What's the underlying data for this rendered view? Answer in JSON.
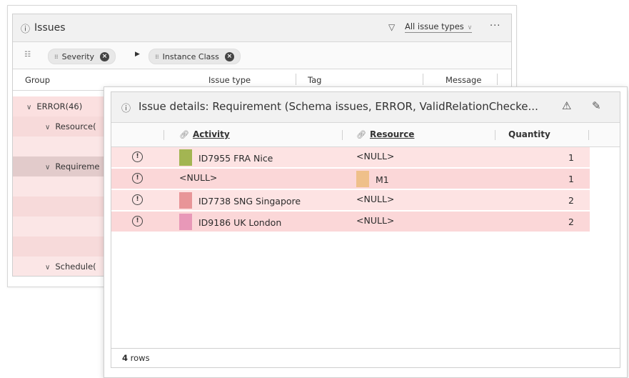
{
  "issues_panel": {
    "title": "Issues",
    "filter_label": "All issue types",
    "more_label": "···",
    "group_chips": [
      "Severity",
      "Instance Class"
    ],
    "columns": [
      "Group",
      "Issue type",
      "Tag",
      "Message"
    ],
    "groups": [
      "ERROR(46)",
      "Resource(",
      "Requireme",
      "Schedule("
    ]
  },
  "details_panel": {
    "title": "Issue details: Requirement (Schema issues, ERROR, ValidRelationChecke...",
    "columns": {
      "activity": "Activity",
      "resource": "Resource",
      "quantity": "Quantity"
    },
    "rows": [
      {
        "activity": "ID7955 FRA Nice",
        "activity_color": "#a3b552",
        "resource": "<NULL>",
        "resource_color": null,
        "quantity": "1"
      },
      {
        "activity": "<NULL>",
        "activity_color": null,
        "resource": "M1",
        "resource_color": "#efc08a",
        "quantity": "1"
      },
      {
        "activity": "ID7738 SNG Singapore",
        "activity_color": "#e89598",
        "resource": "<NULL>",
        "resource_color": null,
        "quantity": "2"
      },
      {
        "activity": "ID9186 UK London",
        "activity_color": "#e898b8",
        "resource": "<NULL>",
        "resource_color": null,
        "quantity": "2"
      }
    ],
    "row_count_number": "4",
    "row_count_label": "rows"
  }
}
